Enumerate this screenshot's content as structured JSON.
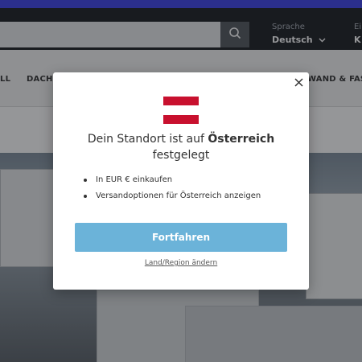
{
  "header": {
    "language_label": "Sprache",
    "language_value": "Deutsch",
    "unit_label": "Ei",
    "unit_value": "K"
  },
  "search": {
    "value": "",
    "placeholder": ""
  },
  "icons": {
    "search": "search-icon",
    "chevron": "chevron-down-icon",
    "close": "close-icon"
  },
  "nav": {
    "items": [
      "LL",
      "DACH",
      "WAND & FASSA"
    ]
  },
  "modal": {
    "title_prefix": "Dein Standort ist auf ",
    "title_country": "Österreich",
    "title_suffix": "festgelegt",
    "bullets": [
      "In EUR € einkaufen",
      "Versandoptionen für Österreich anzeigen"
    ],
    "continue_label": "Fortfahren",
    "change_link": "Land/Region ändern",
    "flag_colors": [
      "#c8102e",
      "#ffffff",
      "#c8102e"
    ]
  },
  "colors": {
    "accent_button": "#6bb3d9",
    "header_bg": "#1c1f24",
    "top_strip": "#2b2f8c"
  }
}
